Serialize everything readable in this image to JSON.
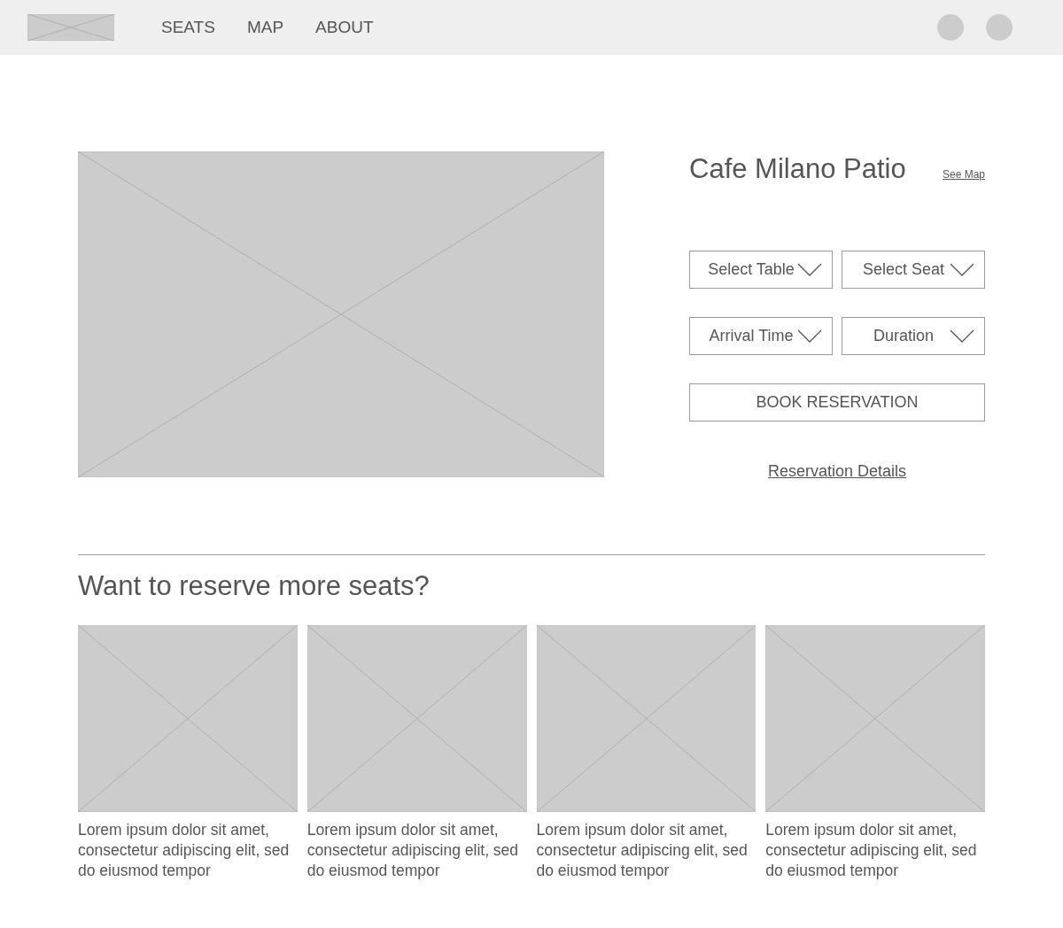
{
  "nav": {
    "links": [
      {
        "label": "SEATS"
      },
      {
        "label": "MAP"
      },
      {
        "label": "ABOUT"
      }
    ]
  },
  "venue": {
    "title": "Cafe Milano Patio",
    "map_link": "See Map",
    "selects": [
      {
        "label": "Select Table"
      },
      {
        "label": "Select Seat"
      },
      {
        "label": "Arrival Time"
      },
      {
        "label": "Duration"
      }
    ],
    "book_button": "BOOK RESERVATION",
    "details_link": "Reservation Details"
  },
  "more": {
    "heading": "Want to reserve more seats?",
    "cards": [
      {
        "text": "Lorem ipsum dolor sit amet, consectetur adipiscing elit, sed do eiusmod tempor"
      },
      {
        "text": "Lorem ipsum dolor sit amet, consectetur adipiscing elit, sed do eiusmod tempor"
      },
      {
        "text": "Lorem ipsum dolor sit amet, consectetur adipiscing elit, sed do eiusmod tempor"
      },
      {
        "text": "Lorem ipsum dolor sit amet, consectetur adipiscing elit, sed do eiusmod tempor"
      }
    ]
  }
}
